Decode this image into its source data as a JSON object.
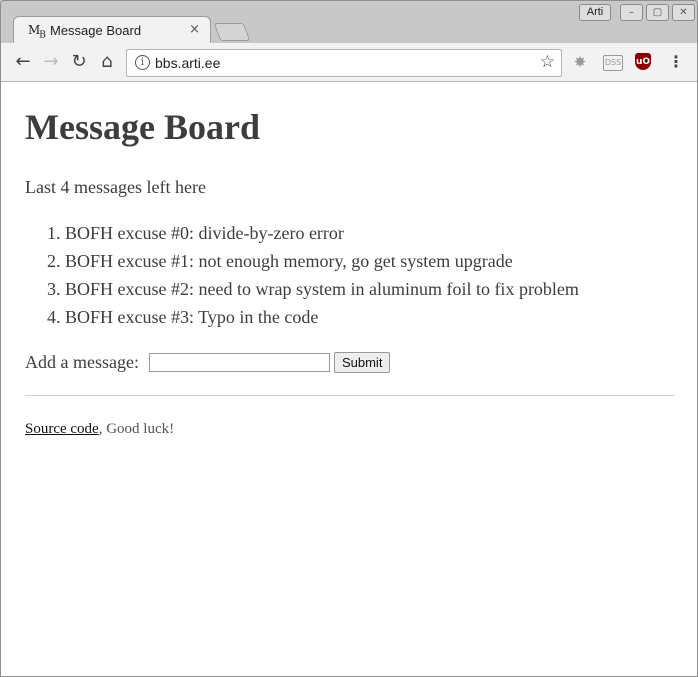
{
  "browser": {
    "tab_title": "Message Board",
    "favicon_text": "MB",
    "tab_close": "×",
    "profile_name": "Arti",
    "url": "bbs.arti.ee"
  },
  "page": {
    "heading": "Message Board",
    "lead": "Last 4 messages left here",
    "messages": [
      "BOFH excuse #0: divide-by-zero error",
      "BOFH excuse #1: not enough memory, go get system upgrade",
      "BOFH excuse #2: need to wrap system in aluminum foil to fix problem",
      "BOFH excuse #3: Typo in the code"
    ],
    "form": {
      "label": "Add a message:",
      "input_value": "",
      "submit_label": "Submit"
    },
    "footer": {
      "link_text": "Source code",
      "separator": ",",
      "note": "Good luck!"
    }
  },
  "icons": {
    "back": "back-arrow-icon",
    "forward": "forward-arrow-icon",
    "reload": "reload-icon",
    "home": "home-icon",
    "info": "info-icon",
    "bookmark": "star-icon",
    "ext1": "burst-extension-icon",
    "ext2": "dss-extension-icon",
    "ext3": "ublock-origin-icon",
    "menu": "kebab-menu-icon"
  }
}
